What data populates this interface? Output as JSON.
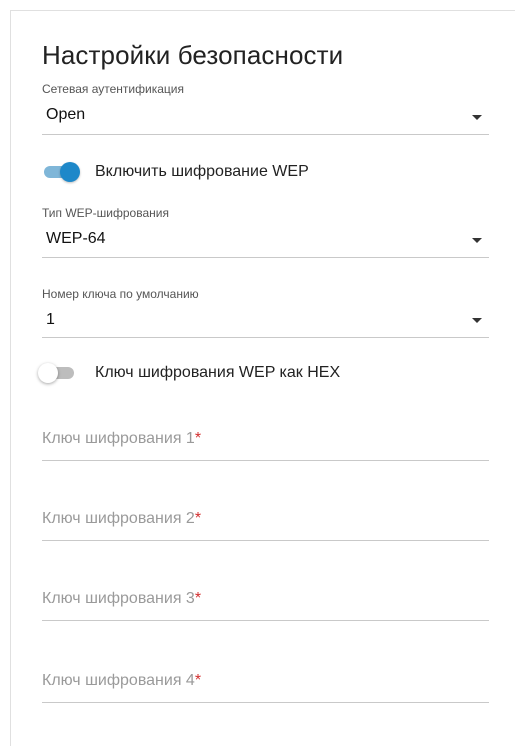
{
  "title": "Настройки безопасности",
  "auth": {
    "label": "Сетевая аутентификация",
    "value": "Open"
  },
  "wep_toggle": {
    "label": "Включить шифрование WEP",
    "on": true
  },
  "wep_type": {
    "label": "Тип WEP-шифрования",
    "value": "WEP-64"
  },
  "default_key": {
    "label": "Номер ключа по умолчанию",
    "value": "1"
  },
  "hex_toggle": {
    "label": "Ключ шифрования WEP как HEX",
    "on": false
  },
  "keys": [
    {
      "placeholder": "Ключ шифрования 1",
      "required_mark": "*"
    },
    {
      "placeholder": "Ключ шифрования 2",
      "required_mark": "*"
    },
    {
      "placeholder": "Ключ шифрования 3",
      "required_mark": "*"
    },
    {
      "placeholder": "Ключ шифрования 4",
      "required_mark": "*"
    }
  ],
  "colors": {
    "accent": "#1e88c9",
    "required": "#d32f2f"
  },
  "icons": {
    "dropdown": "chevron-down-icon"
  }
}
